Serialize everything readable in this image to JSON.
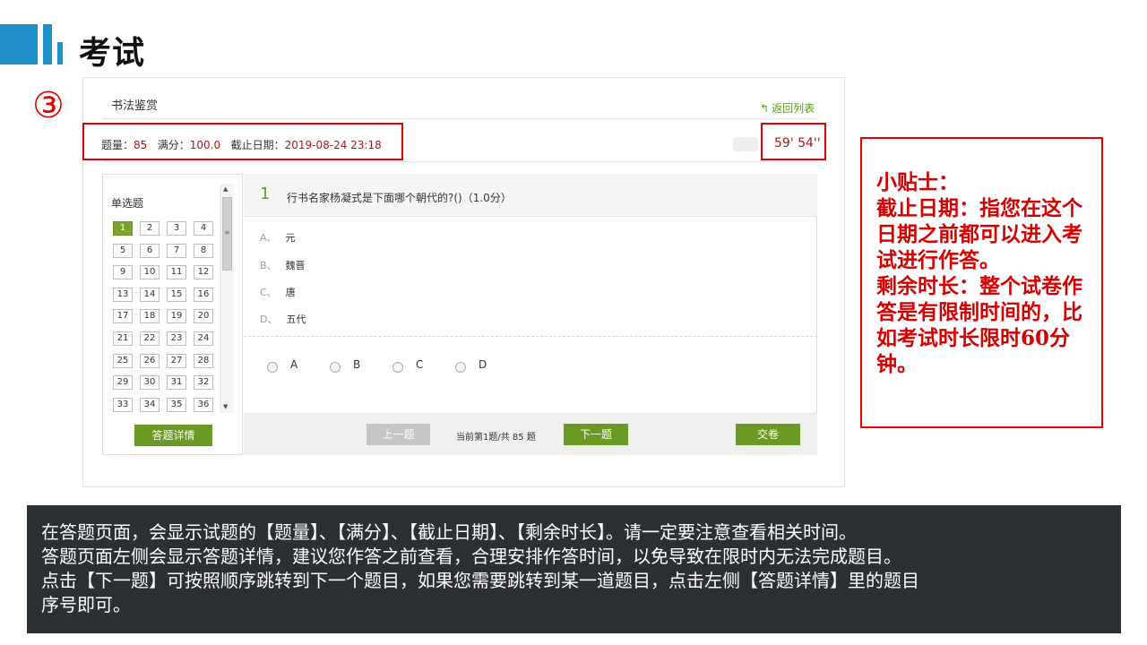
{
  "slide": {
    "title": "考试",
    "step": "③"
  },
  "exam": {
    "course_title": "书法鉴赏",
    "back_link": "返回列表",
    "info": {
      "count_label": "题量：",
      "count_value": "85",
      "score_label": "满分：",
      "score_value": "100.0",
      "deadline_label": "截止日期：",
      "deadline_value": "2019-08-24 23:18"
    },
    "timer": "59' 54''",
    "sidebar": {
      "section_title": "单选题",
      "numbers": [
        "1",
        "2",
        "3",
        "4",
        "5",
        "6",
        "7",
        "8",
        "9",
        "10",
        "11",
        "12",
        "13",
        "14",
        "15",
        "16",
        "17",
        "18",
        "19",
        "20",
        "21",
        "22",
        "23",
        "24",
        "25",
        "26",
        "27",
        "28",
        "29",
        "30",
        "31",
        "32",
        "33",
        "34",
        "35",
        "36"
      ],
      "current": "1",
      "detail_button": "答题详情"
    },
    "question": {
      "number": "1",
      "text": "行书名家杨凝式是下面哪个朝代的?()（1.0分）",
      "options": [
        {
          "letter": "A、",
          "text": "元"
        },
        {
          "letter": "B、",
          "text": "魏晋"
        },
        {
          "letter": "C、",
          "text": "唐"
        },
        {
          "letter": "D、",
          "text": "五代"
        }
      ],
      "choices": [
        "A",
        "B",
        "C",
        "D"
      ]
    },
    "footer": {
      "prev": "上一题",
      "page_info": "当前第1题/共 85 题",
      "next": "下一题",
      "submit": "交卷"
    }
  },
  "tips": {
    "lines": [
      "小贴士：",
      "截止日期：指您在这个日期之前都可以进入考试进行作答。",
      "剩余时长：整个试卷作答是有限制时间的，比如考试时长限时60分钟。"
    ]
  },
  "caption": {
    "lines": [
      "在答题页面，会显示试题的【题量】、【满分】、【截止日期】、【剩余时长】。请一定要注意查看相关时间。",
      "答题页面左侧会显示答题详情，建议您作答之前查看，合理安排作答时间，以免导致在限时内无法完成题目。",
      "点击【下一题】可按照顺序跳转到下一个题目，如果您需要跳转到某一道题目，点击左侧【答题详情】里的题目",
      "序号即可。"
    ]
  },
  "colors": {
    "accent_blue": "#1f8fc8",
    "green": "#6b9a23",
    "red": "#e00000"
  }
}
